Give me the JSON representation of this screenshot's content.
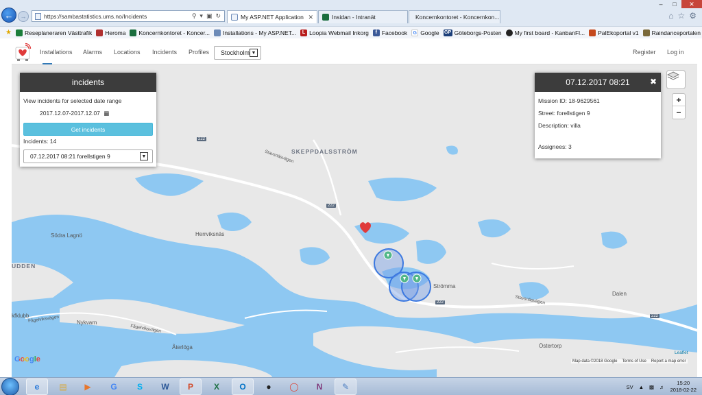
{
  "browser": {
    "url": "https://sambastatistics.ums.no/Incidents",
    "tabs": [
      {
        "label": "My ASP.NET Application",
        "active": true
      },
      {
        "label": "Insidan - Intranät",
        "active": false
      },
      {
        "label": "Koncernkontoret - Koncernkon...",
        "active": false
      }
    ],
    "favorites": [
      {
        "label": "Reseplaneraren  Västtrafik",
        "icon": "vasttrafik-icon",
        "color": "#1b7e3b"
      },
      {
        "label": "Heroma",
        "icon": "heroma-icon",
        "color": "#b0302f"
      },
      {
        "label": "Koncernkontoret - Koncer...",
        "icon": "vgr-icon",
        "color": "#1a6d3e"
      },
      {
        "label": "Installations - My ASP.NET...",
        "icon": "page-icon",
        "color": "#6d8bb8"
      },
      {
        "label": "Loopia Webmail Inkorg",
        "icon": "loopia-icon",
        "color": "#b81d1d"
      },
      {
        "label": "Facebook",
        "icon": "facebook-icon",
        "color": "#3b5998"
      },
      {
        "label": "Google",
        "icon": "google-icon",
        "color": "#4285f4"
      },
      {
        "label": "Göteborgs-Posten",
        "icon": "gp-icon",
        "color": "#1c3f7a"
      },
      {
        "label": "My first board - KanbanFl...",
        "icon": "kanban-icon",
        "color": "#222222"
      },
      {
        "label": "PalEkoportal v1",
        "icon": "palekoportal-icon",
        "color": "#c54a1e"
      },
      {
        "label": "Raindanceportalen",
        "icon": "raindance-icon",
        "color": "#7b6a3a"
      }
    ]
  },
  "navbar": {
    "links": [
      "Installations",
      "Alarms",
      "Locations",
      "Incidents",
      "Profiles"
    ],
    "city": "Stockholm",
    "register": "Register",
    "login": "Log in"
  },
  "incidents_panel": {
    "title": "incidents",
    "description": "View incidents for selected date range",
    "date_range": "2017.12.07-2017.12.07",
    "button": "Get incidents",
    "count": "Incidents: 14",
    "selected": "07.12.2017 08:21 forellstigen 9"
  },
  "detail_popup": {
    "title": "07.12.2017 08:21",
    "mission_id": "Mission ID: 18-9629561",
    "street": "Street: forellstigen 9",
    "description": "Description: villa",
    "assignees": "Assignees: 3"
  },
  "map": {
    "labels": {
      "skeppdalsstrom": "SKEPPDALSSTRÖM",
      "sodra_lagno": "Södra Lagnö",
      "herrviksnas": "Herrviksnäs",
      "udden": "UDDEN",
      "nykvarn": "Nykvarn",
      "stromma": "Strömma",
      "dalen": "Dalen",
      "aterloga": "Återlöga",
      "ostertorp": "Östertorp",
      "kfklubb": "kfklubb",
      "stavsnasvagen": "Stavsnäsvägen",
      "fagelviksvagen": "Fågelviksvägen"
    },
    "road_number": "222",
    "attribution": [
      "Map data ©2018 Google",
      "Terms of Use",
      "Report a map error"
    ],
    "google_logo": "Google",
    "leaflet": "Leaflet",
    "heart_color": "#e03a3a"
  },
  "taskbar": {
    "language": "SV",
    "time": "15:20",
    "date": "2018-02-22"
  }
}
